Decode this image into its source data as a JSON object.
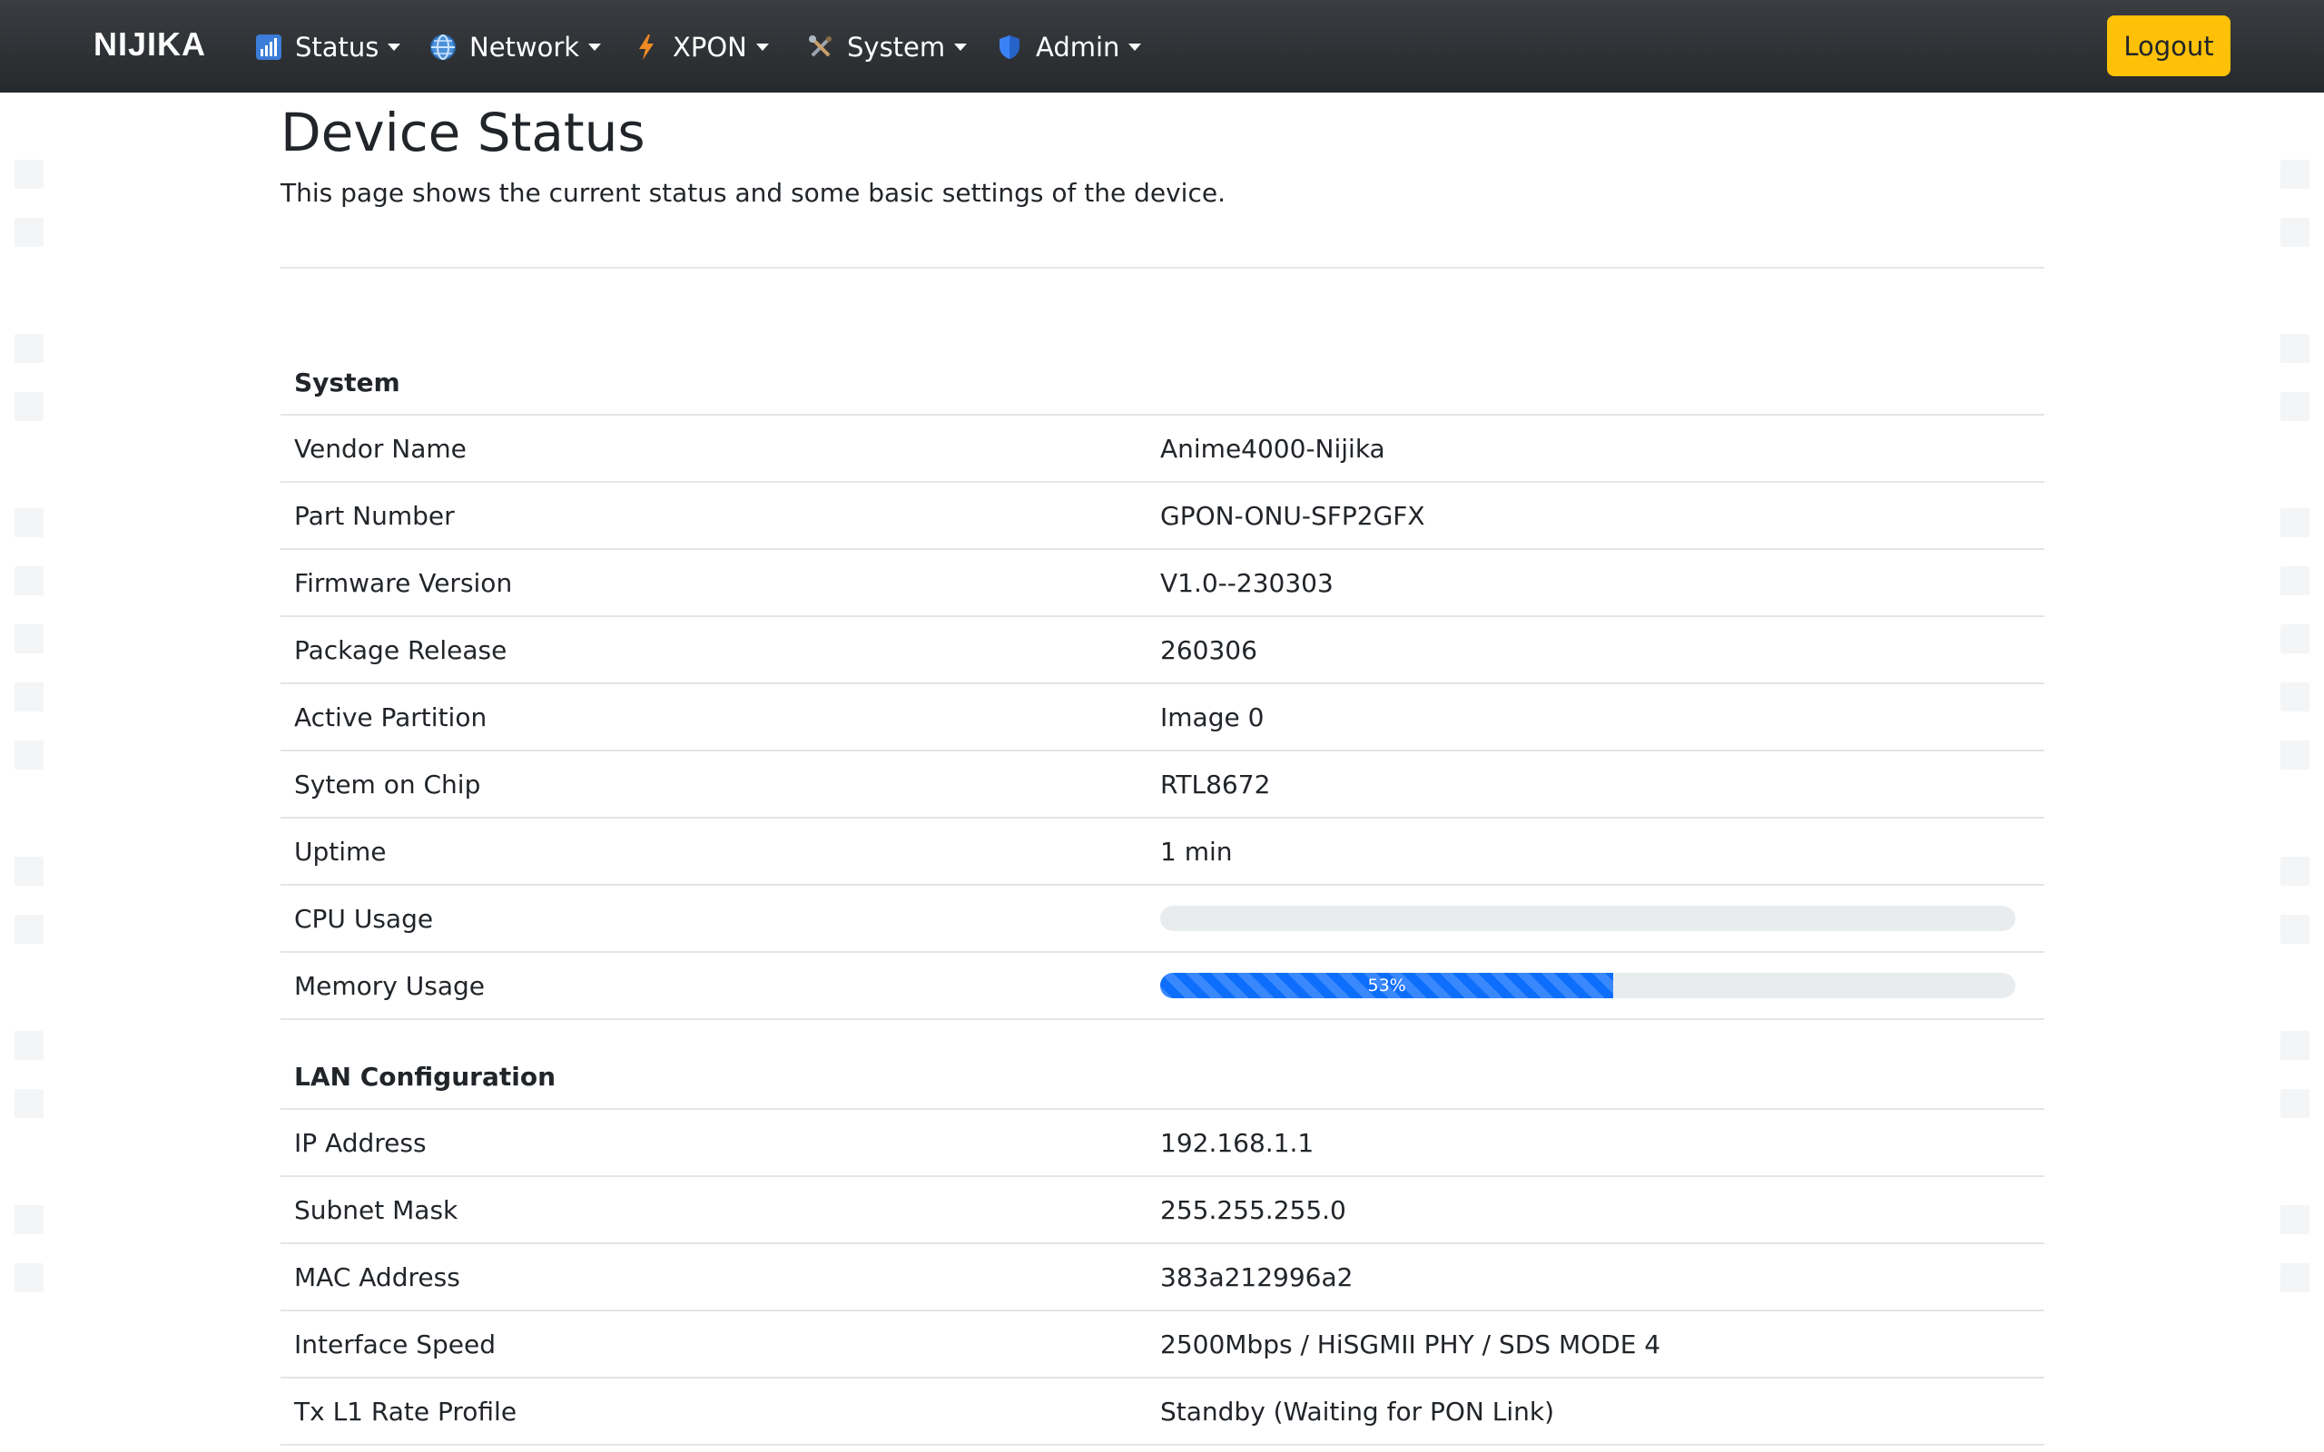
{
  "navbar": {
    "brand": "NIJIKA",
    "items": [
      {
        "label": "Status",
        "icon": "bar-chart-icon"
      },
      {
        "label": "Network",
        "icon": "globe-icon"
      },
      {
        "label": "XPON",
        "icon": "lightning-icon"
      },
      {
        "label": "System",
        "icon": "tools-icon"
      },
      {
        "label": "Admin",
        "icon": "shield-icon"
      }
    ],
    "logout_label": "Logout"
  },
  "page": {
    "title": "Device Status",
    "description": "This page shows the current status and some basic settings of the device."
  },
  "system": {
    "heading": "System",
    "rows": [
      {
        "key": "Vendor Name",
        "value": "Anime4000-Nijika"
      },
      {
        "key": "Part Number",
        "value": "GPON-ONU-SFP2GFX"
      },
      {
        "key": "Firmware Version",
        "value": "V1.0--230303"
      },
      {
        "key": "Package Release",
        "value": "260306"
      },
      {
        "key": "Active Partition",
        "value": "Image 0"
      },
      {
        "key": "Sytem on Chip",
        "value": "RTL8672"
      },
      {
        "key": "Uptime",
        "value": "1 min"
      }
    ],
    "cpu_label": "CPU Usage",
    "cpu_percent": 0,
    "memory_label": "Memory Usage",
    "memory_percent": 53,
    "memory_text": "53%"
  },
  "lan": {
    "heading": "LAN Configuration",
    "rows": [
      {
        "key": "IP Address",
        "value": "192.168.1.1"
      },
      {
        "key": "Subnet Mask",
        "value": "255.255.255.0"
      },
      {
        "key": "MAC Address",
        "value": "383a212996a2"
      },
      {
        "key": "Interface Speed",
        "value": "2500Mbps / HiSGMII PHY / SDS MODE 4"
      },
      {
        "key": "Tx L1 Rate Profile",
        "value": "Standby (Waiting for PON Link)"
      }
    ]
  },
  "colors": {
    "navbar": "#2f3235",
    "accent_button": "#ffc107",
    "progress_bar": "#0d6efd",
    "progress_track": "#e9ecef"
  }
}
